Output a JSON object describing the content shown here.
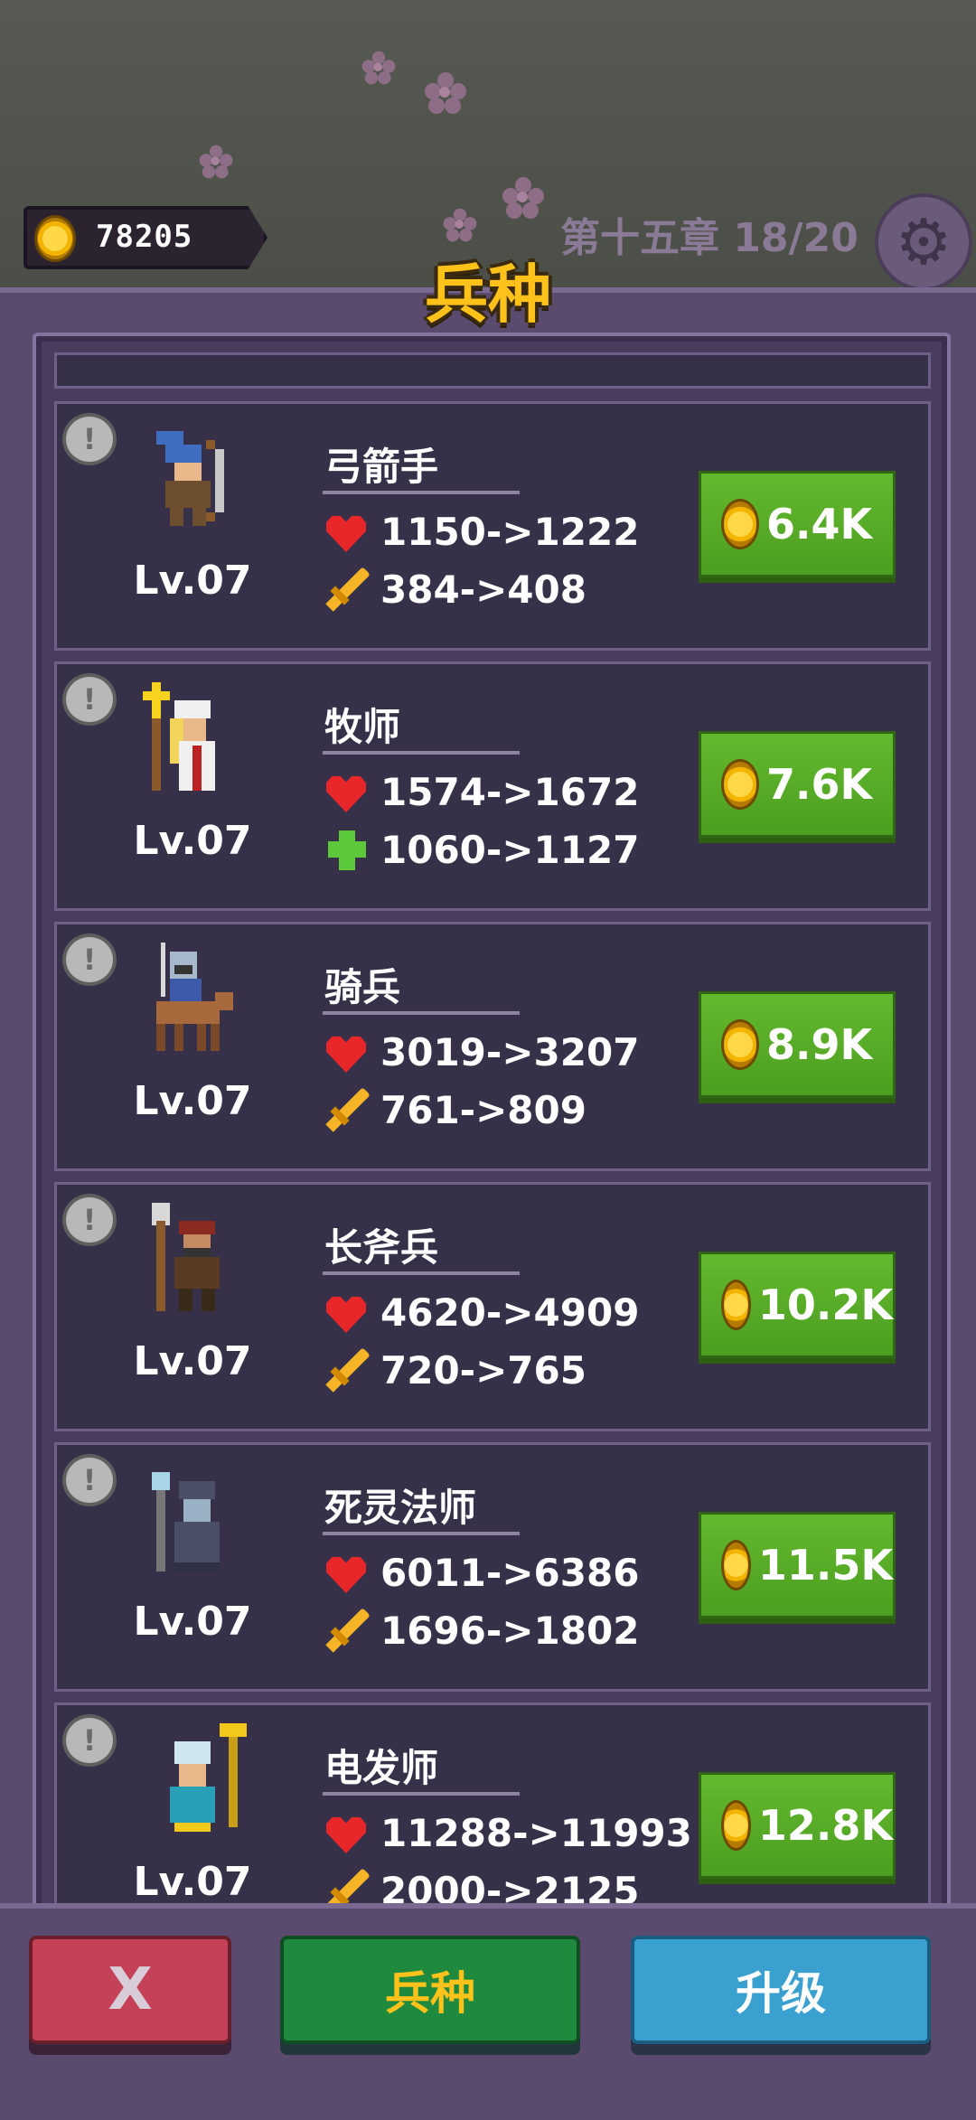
{
  "header": {
    "coins": "78205",
    "chapter": "第十五章 18/20"
  },
  "panel": {
    "title": "兵种"
  },
  "units": [
    {
      "name": "弓箭手",
      "level": "Lv.07",
      "hp": "1150->1222",
      "stat2_icon": "sword-icon",
      "stat2": "384->408",
      "cost": "6.4K"
    },
    {
      "name": "牧师",
      "level": "Lv.07",
      "hp": "1574->1672",
      "stat2_icon": "heal-plus-icon",
      "stat2": "1060->1127",
      "cost": "7.6K"
    },
    {
      "name": "骑兵",
      "level": "Lv.07",
      "hp": "3019->3207",
      "stat2_icon": "sword-icon",
      "stat2": "761->809",
      "cost": "8.9K"
    },
    {
      "name": "长斧兵",
      "level": "Lv.07",
      "hp": "4620->4909",
      "stat2_icon": "sword-icon",
      "stat2": "720->765",
      "cost": "10.2K"
    },
    {
      "name": "死灵法师",
      "level": "Lv.07",
      "hp": "6011->6386",
      "stat2_icon": "sword-icon",
      "stat2": "1696->1802",
      "cost": "11.5K"
    },
    {
      "name": "电发师",
      "level": "Lv.07",
      "hp": "11288->11993",
      "stat2_icon": "sword-icon",
      "stat2": "2000->2125",
      "cost": "12.8K"
    }
  ],
  "bottom": {
    "close_label": "X",
    "units_label": "兵种",
    "upgrade_label": "升级"
  },
  "colors": {
    "panel": "#5a4b6e",
    "title_gold": "#ffc21a",
    "buy_green": "#4c9e20"
  }
}
